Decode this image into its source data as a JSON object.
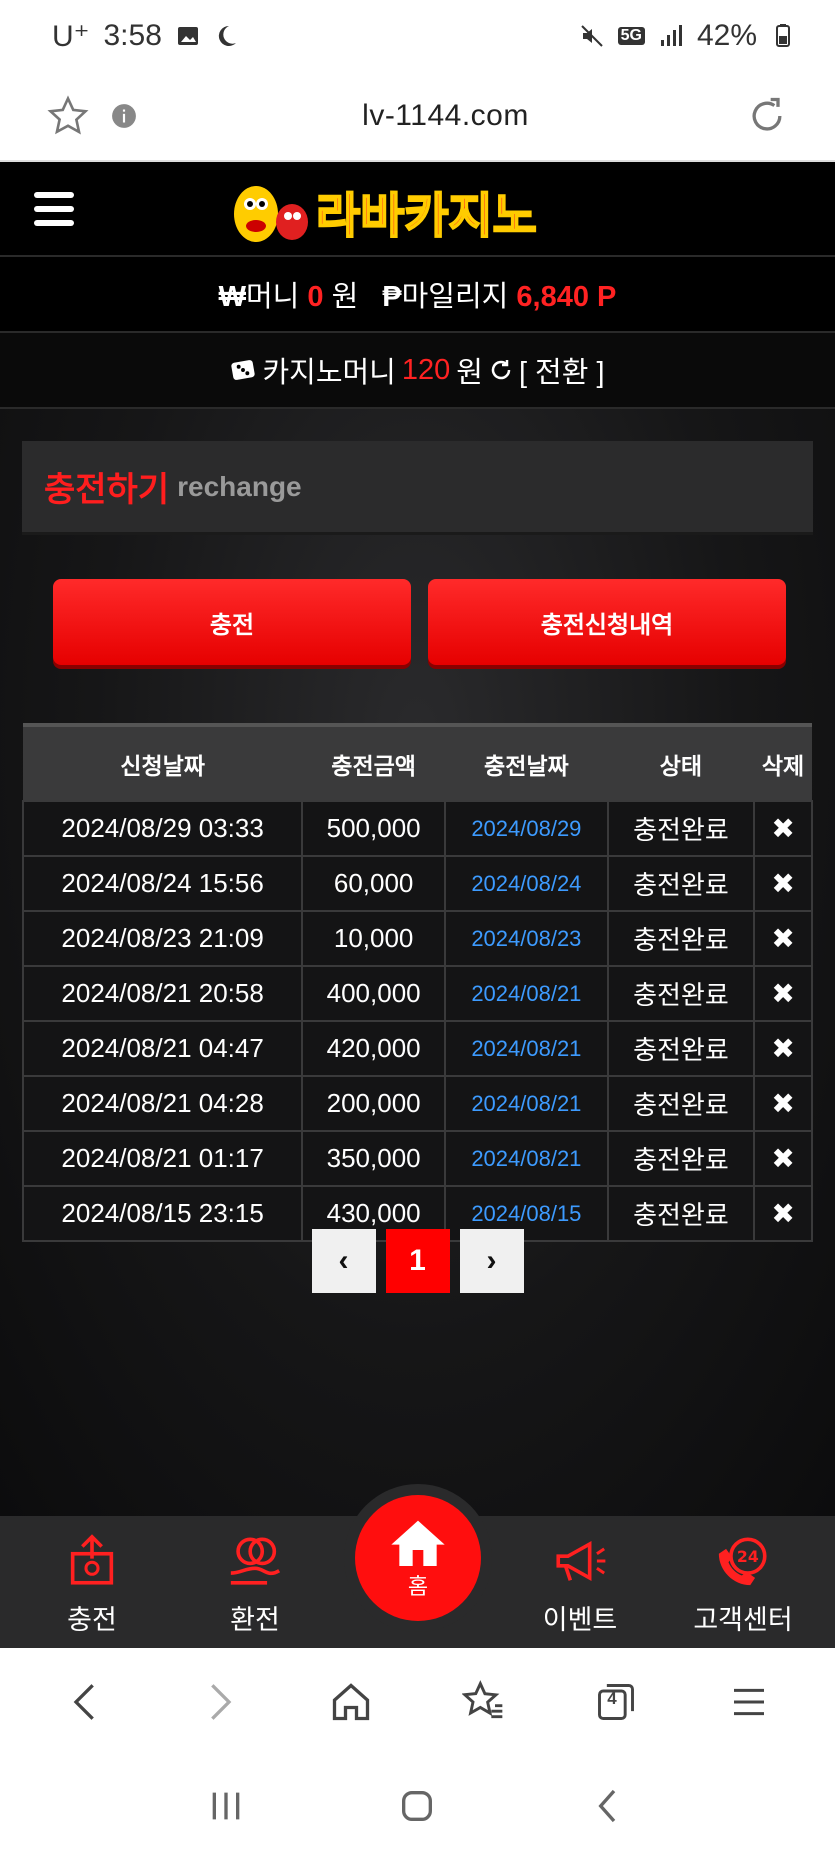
{
  "status_bar": {
    "carrier": "U⁺",
    "time": "3:58",
    "network": "5G",
    "battery": "42%"
  },
  "browser": {
    "url": "lv-1144.com",
    "tabs_count": "4"
  },
  "site": {
    "money_row": {
      "money_label": "머니",
      "money_value": "0",
      "money_unit": "원",
      "mileage_label": "마일리지",
      "mileage_value": "6,840 P"
    },
    "casino_row": {
      "label": "카지노머니",
      "value": "120",
      "unit": "원",
      "convert_label": "[ 전환 ]"
    },
    "page_title": {
      "korean": "충전하기",
      "english": "rechange"
    },
    "buttons": {
      "charge": "충전",
      "history": "충전신청내역"
    },
    "table": {
      "headers": [
        "신청날짜",
        "충전금액",
        "충전날짜",
        "상태",
        "삭제"
      ],
      "rows": [
        {
          "requested": "2024/08/29 03:33",
          "amount": "500,000",
          "charged": "2024/08/29",
          "status": "충전완료"
        },
        {
          "requested": "2024/08/24 15:56",
          "amount": "60,000",
          "charged": "2024/08/24",
          "status": "충전완료"
        },
        {
          "requested": "2024/08/23 21:09",
          "amount": "10,000",
          "charged": "2024/08/23",
          "status": "충전완료"
        },
        {
          "requested": "2024/08/21 20:58",
          "amount": "400,000",
          "charged": "2024/08/21",
          "status": "충전완료"
        },
        {
          "requested": "2024/08/21 04:47",
          "amount": "420,000",
          "charged": "2024/08/21",
          "status": "충전완료"
        },
        {
          "requested": "2024/08/21 04:28",
          "amount": "200,000",
          "charged": "2024/08/21",
          "status": "충전완료"
        },
        {
          "requested": "2024/08/21 01:17",
          "amount": "350,000",
          "charged": "2024/08/21",
          "status": "충전완료"
        },
        {
          "requested": "2024/08/15 23:15",
          "amount": "430,000",
          "charged": "2024/08/15",
          "status": "충전완료"
        }
      ]
    },
    "pagination": {
      "current_page": "1",
      "prev": "‹",
      "next": "›"
    },
    "bottom_nav": {
      "charge": "충전",
      "exchange": "환전",
      "home": "홈",
      "event": "이벤트",
      "support": "고객센터"
    }
  },
  "colors": {
    "accent_red": "#ff0000",
    "link_blue": "#3d9bff"
  }
}
